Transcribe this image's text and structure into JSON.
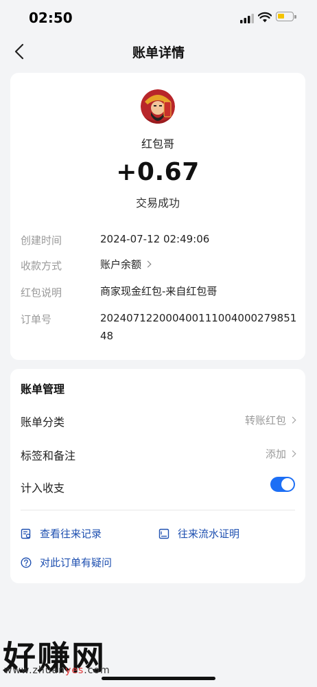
{
  "status_bar": {
    "time": "02:50"
  },
  "nav": {
    "title": "账单详情"
  },
  "summary": {
    "merchant": "红包哥",
    "amount": "+0.67",
    "status": "交易成功"
  },
  "details": [
    {
      "label": "创建时间",
      "value": "2024-07-12 02:49:06"
    },
    {
      "label": "收款方式",
      "value": "账户余额"
    },
    {
      "label": "红包说明",
      "value": "商家现金红包-来自红包哥"
    },
    {
      "label": "订单号",
      "value": "20240712200040011100400027985148"
    }
  ],
  "management": {
    "title": "账单管理",
    "category": {
      "label": "账单分类",
      "value": "转账红包"
    },
    "tags": {
      "label": "标签和备注",
      "value": "添加"
    },
    "count": {
      "label": "计入收支",
      "enabled": true
    },
    "links": {
      "records": "查看往来记录",
      "proof": "往来流水证明",
      "question": "对此订单有疑问"
    }
  },
  "watermark": {
    "text": "好赚网",
    "url_prefix": "www.zhuan",
    "url_highlight": "yes",
    "url_suffix": ".com"
  },
  "colors": {
    "accent": "#1d6ff5",
    "link": "#1d4fb0",
    "battery": "#f5c400"
  }
}
